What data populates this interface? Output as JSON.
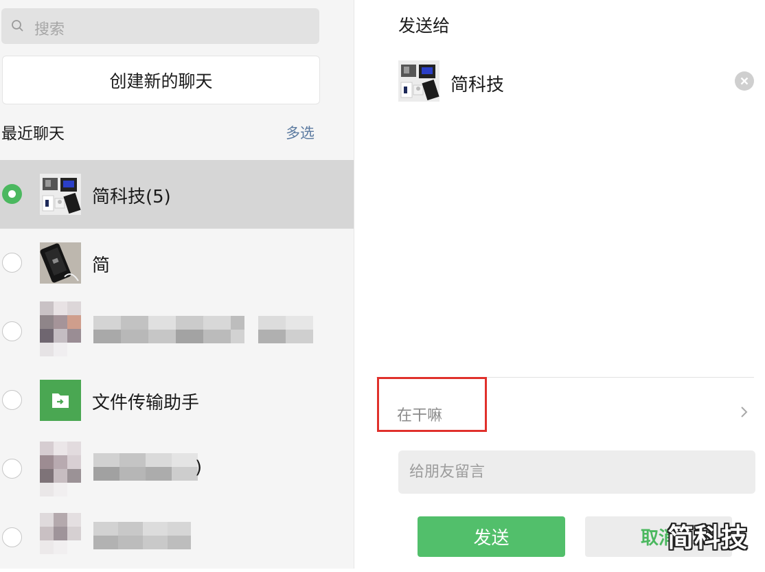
{
  "search": {
    "placeholder": "搜索"
  },
  "new_chat_label": "创建新的聊天",
  "recent": {
    "title": "最近聊天",
    "multi_select": "多选"
  },
  "contacts": [
    {
      "name": "简科技(5)",
      "selected": true,
      "avatar_icon": "group-photo-avatar"
    },
    {
      "name": "简",
      "selected": false,
      "avatar_icon": "phone-photo-avatar"
    },
    {
      "name": "",
      "selected": false,
      "avatar_icon": "blurred-avatar"
    },
    {
      "name": "文件传输助手",
      "selected": false,
      "avatar_icon": "file-transfer-icon"
    },
    {
      "name": ")",
      "selected": false,
      "avatar_icon": "blurred-avatar"
    },
    {
      "name": "",
      "selected": false,
      "avatar_icon": "blurred-avatar"
    }
  ],
  "right": {
    "title": "发送给",
    "target_name": "简科技",
    "message_preview": "在干嘛",
    "note_placeholder": "给朋友留言",
    "send_label": "发送",
    "cancel_label": "取消"
  },
  "watermark": "简科技",
  "colors": {
    "accent_green": "#52bf6b",
    "highlight_red": "#e0302b",
    "link_blue": "#5b7aa0"
  }
}
